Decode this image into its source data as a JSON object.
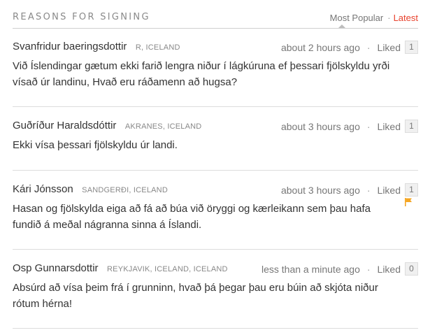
{
  "header": {
    "title": "REASONS FOR SIGNING",
    "sort_popular": "Most Popular",
    "sort_separator": "·",
    "sort_latest": "Latest"
  },
  "colors": {
    "accent": "#e8412c",
    "flag": "#f5a623"
  },
  "meta_separator": "·",
  "comments": [
    {
      "author": "Svanfridur baeringsdottir",
      "location": "R, ICELAND",
      "time": "about 2 hours ago",
      "liked_label": "Liked",
      "likes": "1",
      "text": "Við Íslendingar gætum ekki farið lengra niður í lágkúruna ef þessari fjölskyldu yrði vísað úr landinu, Hvað eru ráðamenn að hugsa?"
    },
    {
      "author": "Guðríður Haraldsdóttir",
      "location": "AKRANES, ICELAND",
      "time": "about 3 hours ago",
      "liked_label": "Liked",
      "likes": "1",
      "text": "Ekki vísa þessari fjölskyldu úr landi."
    },
    {
      "author": "Kári Jónsson",
      "location": "SANDGERÐI, ICELAND",
      "time": "about 3 hours ago",
      "liked_label": "Liked",
      "likes": "1",
      "text": "Hasan og fjölskylda eiga að fá að búa við öryggi og kærleikann sem þau hafa fundið á meðal nágranna sinna á Íslandi.",
      "flag_icon": "flag-icon"
    },
    {
      "author": "Osp Gunnarsdottir",
      "location": "REYKJAVIK, ICELAND, ICELAND",
      "time": "less than a minute ago",
      "liked_label": "Liked",
      "likes": "0",
      "text": "Absúrd að vísa þeim frá í grunninn, hvað þá þegar þau eru búin að skjóta niður rótum hérna!"
    }
  ]
}
